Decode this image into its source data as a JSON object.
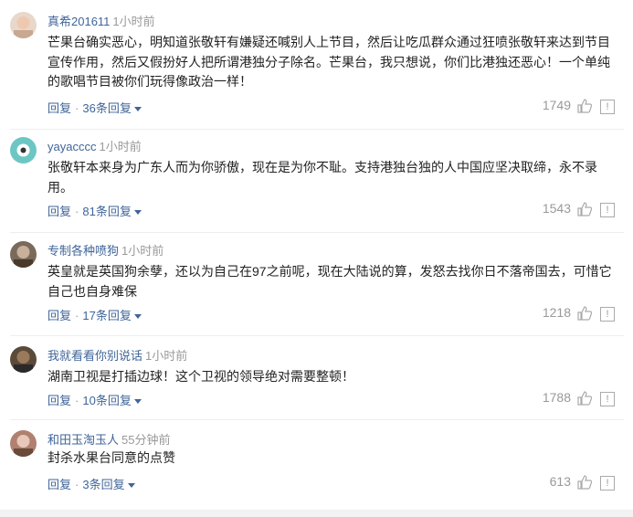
{
  "comments": [
    {
      "user": "真希201611",
      "time": "1小时前",
      "text": "芒果台确实恶心，明知道张敬轩有嫌疑还喊别人上节目，然后让吃瓜群众通过狂喷张敬轩来达到节目宣传作用，然后又假扮好人把所谓港独分子除名。芒果台，我只想说，你们比港独还恶心！一个单纯的歌唱节目被你们玩得像政治一样！",
      "reply_label": "回复",
      "replies_label": "36条回复",
      "likes": "1749",
      "avatar_color": "#e8d0c0"
    },
    {
      "user": "yayacccc",
      "time": "1小时前",
      "text": "张敬轩本来身为广东人而为你骄傲，现在是为你不耻。支持港独台独的人中国应坚决取缔，永不录用。",
      "reply_label": "回复",
      "replies_label": "81条回复",
      "likes": "1543",
      "avatar_color": "#6cc7c4"
    },
    {
      "user": "专制各种喷狗",
      "time": "1小时前",
      "text": "英皇就是英国狗余孽，还以为自己在97之前呢，现在大陆说的算，发怒去找你日不落帝国去，可惜它自己也自身难保",
      "reply_label": "回复",
      "replies_label": "17条回复",
      "likes": "1218",
      "avatar_color": "#7a6a5a"
    },
    {
      "user": "我就看看你别说话",
      "time": "1小时前",
      "text": "湖南卫视是打插边球！这个卫视的领导绝对需要整顿！",
      "reply_label": "回复",
      "replies_label": "10条回复",
      "likes": "1788",
      "avatar_color": "#5a4a3a"
    },
    {
      "user": "和田玉淘玉人",
      "time": "55分钟前",
      "text": "封杀水果台同意的点赞",
      "reply_label": "回复",
      "replies_label": "3条回复",
      "likes": "613",
      "avatar_color": "#b08070"
    }
  ]
}
